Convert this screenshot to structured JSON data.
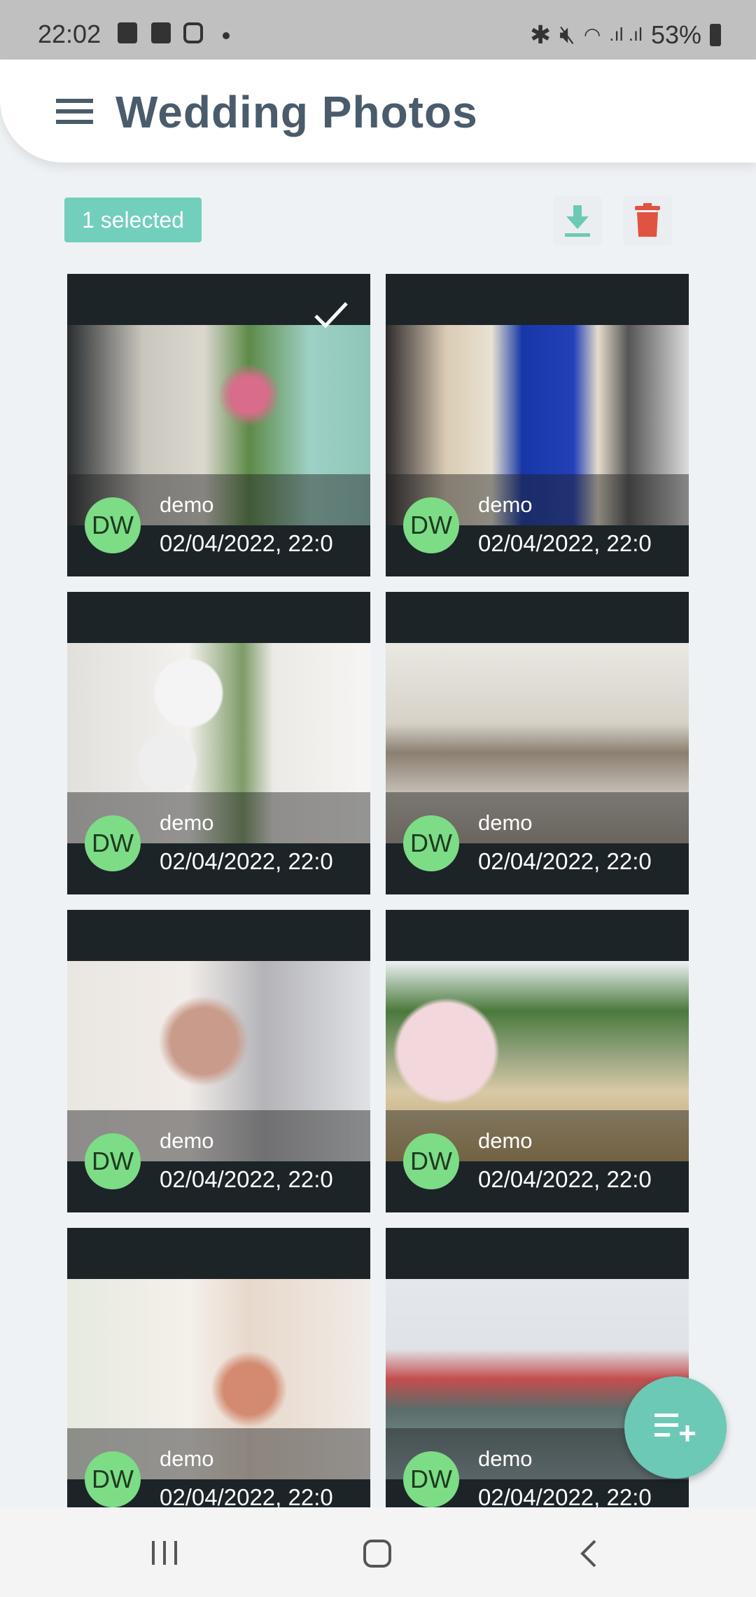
{
  "status_bar": {
    "time": "22:02",
    "battery": "53%"
  },
  "header": {
    "title": "Wedding Photos"
  },
  "toolbar": {
    "selected_label": "1 selected",
    "accent": "#72cfbc",
    "delete_color": "#e05340"
  },
  "photos": [
    {
      "user": "demo",
      "initials": "DW",
      "date": "02/04/2022, 22:0",
      "selected": true
    },
    {
      "user": "demo",
      "initials": "DW",
      "date": "02/04/2022, 22:0",
      "selected": false
    },
    {
      "user": "demo",
      "initials": "DW",
      "date": "02/04/2022, 22:0",
      "selected": false
    },
    {
      "user": "demo",
      "initials": "DW",
      "date": "02/04/2022, 22:0",
      "selected": false
    },
    {
      "user": "demo",
      "initials": "DW",
      "date": "02/04/2022, 22:0",
      "selected": false
    },
    {
      "user": "demo",
      "initials": "DW",
      "date": "02/04/2022, 22:0",
      "selected": false
    },
    {
      "user": "demo",
      "initials": "DW",
      "date": "02/04/2022, 22:0",
      "selected": false
    },
    {
      "user": "demo",
      "initials": "DW",
      "date": "02/04/2022, 22:0",
      "selected": false
    }
  ]
}
